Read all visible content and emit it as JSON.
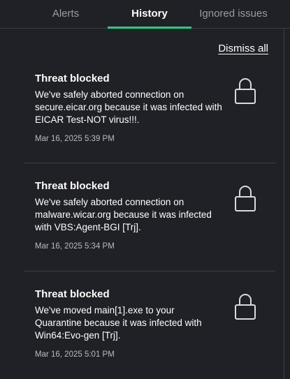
{
  "tabs": [
    {
      "label": "Alerts",
      "active": false
    },
    {
      "label": "History",
      "active": true
    },
    {
      "label": "Ignored issues",
      "active": false
    }
  ],
  "colors": {
    "background": "#1f2126",
    "accent": "#3fbf7f",
    "muted_text": "#9a9ca3"
  },
  "dismiss_all_label": "Dismiss all",
  "items": [
    {
      "title": "Threat blocked",
      "message": "We've safely aborted connection on secure.eicar.org because it was infected with EICAR Test-NOT virus!!!.",
      "time": "Mar 16, 2025 5:39 PM",
      "icon": "lock-icon"
    },
    {
      "title": "Threat blocked",
      "message": "We've safely aborted connection on malware.wicar.org because it was infected with VBS:Agent-BGI [Trj].",
      "time": "Mar 16, 2025 5:34 PM",
      "icon": "lock-icon"
    },
    {
      "title": "Threat blocked",
      "message": "We've moved main[1].exe to your Quarantine because it was infected with Win64:Evo-gen [Trj].",
      "time": "Mar 16, 2025 5:01 PM",
      "icon": "lock-icon"
    }
  ]
}
